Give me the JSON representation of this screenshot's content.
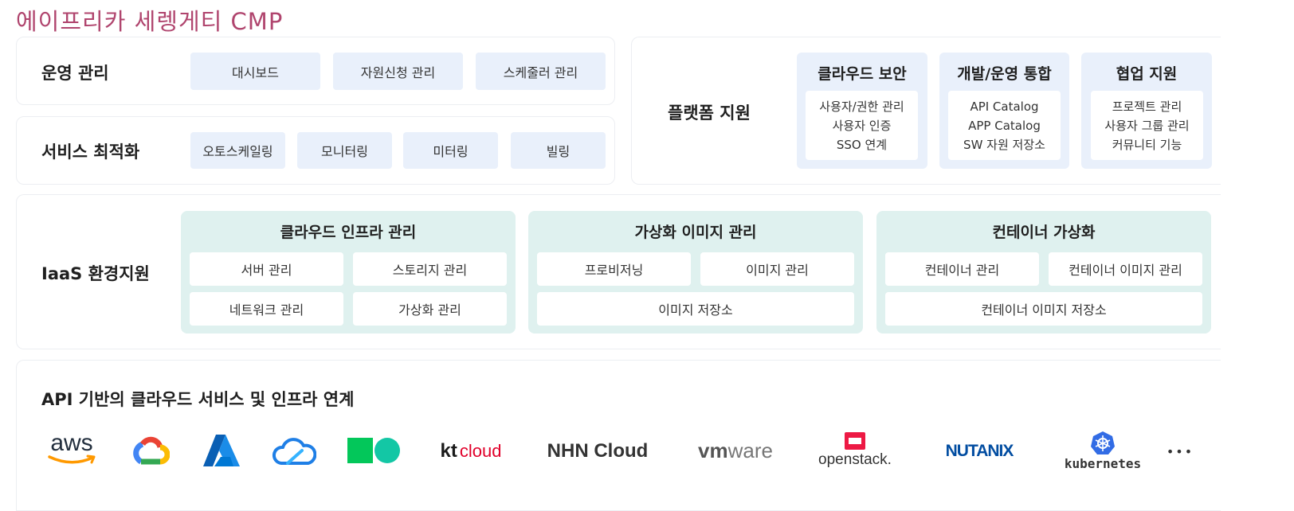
{
  "title": "에이프리카 세렝게티 CMP",
  "operations": {
    "label": "운영 관리",
    "items": [
      "대시보드",
      "자원신청 관리",
      "스케줄러 관리"
    ]
  },
  "optimization": {
    "label": "서비스 최적화",
    "items": [
      "오토스케일링",
      "모니터링",
      "미터링",
      "빌링"
    ]
  },
  "platform": {
    "label": "플랫폼 지원",
    "groups": [
      {
        "title": "클라우드 보안",
        "items": [
          "사용자/권한 관리",
          "사용자 인증",
          "SSO 연계"
        ]
      },
      {
        "title": "개발/운영 통합",
        "items": [
          "API Catalog",
          "APP Catalog",
          "SW 자원 저장소"
        ]
      },
      {
        "title": "협업 지원",
        "items": [
          "프로젝트 관리",
          "사용자 그룹 관리",
          "커뮤니티 기능"
        ]
      }
    ]
  },
  "iaas": {
    "label": "IaaS 환경지원",
    "groups": [
      {
        "title": "클라우드 인프라 관리",
        "cells": [
          "서버 관리",
          "스토리지 관리",
          "네트워크 관리",
          "가상화 관리"
        ]
      },
      {
        "title": "가상화 이미지 관리",
        "cells": [
          "프로비저닝",
          "이미지 관리",
          "이미지 저장소"
        ]
      },
      {
        "title": "컨테이너 가상화",
        "cells": [
          "컨테이너 관리",
          "컨테이너 이미지 관리",
          "컨테이너 이미지 저장소"
        ]
      }
    ]
  },
  "api": {
    "label": "API 기반의 클라우드 서비스 및 인프라 연계",
    "logos": {
      "aws": "aws",
      "kt_main": "kt",
      "kt_sub": "cloud",
      "nhn": "NHN Cloud",
      "vm_bold": "vm",
      "vm_light": "ware",
      "openstack": "openstack.",
      "nutanix": "NUTANIX",
      "kubernetes": "kubernetes",
      "more": "•••"
    },
    "colors": {
      "aws_orange": "#ff9900",
      "azure_blue": "#0078d4",
      "tencent_blue": "#1f7fe6",
      "naver_green": "#03c75a",
      "kt_red": "#e1002a",
      "openstack_red": "#ed1944",
      "nutanix_navy": "#024da1",
      "k8s_blue": "#326ce5"
    }
  }
}
